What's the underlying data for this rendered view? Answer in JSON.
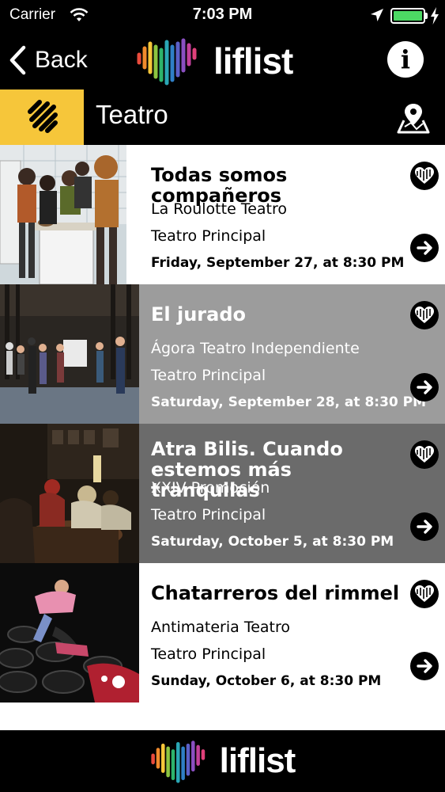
{
  "status_bar": {
    "carrier": "Carrier",
    "time": "7:03 PM",
    "battery_color": "#4cd964"
  },
  "nav": {
    "back_label": "Back",
    "app_name": "liflist",
    "info_label": "i"
  },
  "category": {
    "title": "Teatro",
    "icon": "theatre-icon",
    "accent_color": "#f6c63a"
  },
  "events": [
    {
      "title": "Todas somos compañeros",
      "company": "La Roulotte Teatro",
      "venue": "Teatro Principal",
      "date": "Friday, September 27, at 8:30 PM"
    },
    {
      "title": "El jurado",
      "company": "Ágora Teatro Independiente",
      "venue": "Teatro Principal",
      "date": "Saturday, September 28, at 8:30 PM"
    },
    {
      "title": "Atra Bilis. Cuando estemos más tranquilas",
      "company": "XXIV Promoción",
      "venue": "Teatro Principal",
      "date": "Saturday, October 5, at 8:30 PM"
    },
    {
      "title": "Chatarreros del rimmel",
      "company": "Antimateria Teatro",
      "venue": "Teatro Principal",
      "date": "Sunday, October 6, at 8:30 PM"
    }
  ],
  "footer": {
    "app_name": "liflist"
  }
}
